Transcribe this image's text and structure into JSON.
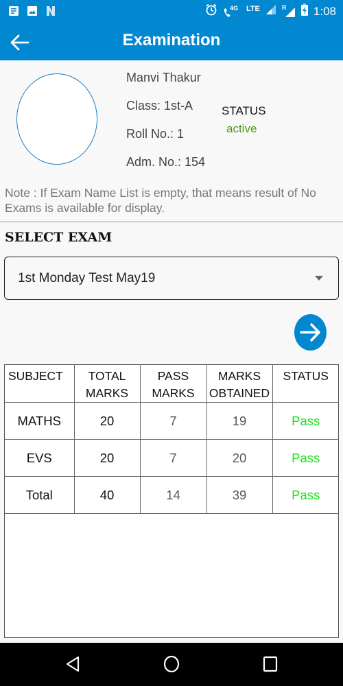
{
  "status_bar": {
    "left_icons": [
      "notes-icon",
      "image-icon",
      "n-app-icon"
    ],
    "right_icons": [
      "alarm-icon",
      "volte-call-icon",
      "signal-icon",
      "roaming-signal-icon",
      "battery-charging-icon"
    ],
    "network_label": "4G",
    "lte_label": "LTE",
    "roaming_label": "R",
    "time": "1:08"
  },
  "app_bar": {
    "title": "Examination",
    "back_icon": "arrow-back-icon"
  },
  "student": {
    "name": "Manvi  Thakur",
    "class": "Class: 1st-A",
    "roll_no": "Roll No.: 1",
    "adm_no": "Adm. No.: 154",
    "status_label": "STATUS",
    "status_value": "active"
  },
  "note": "Note : If Exam Name List is empty, that means result of No Exams is available for display.",
  "select_exam": {
    "heading": "SELECT EXAM",
    "selected": "1st Monday Test May19"
  },
  "results": {
    "headers": {
      "subject": "SUBJECT",
      "total_marks_1": "TOTAL",
      "total_marks_2": "MARKS",
      "pass_marks_1": "PASS",
      "pass_marks_2": "MARKS",
      "marks_obtained_1": "MARKS",
      "marks_obtained_2": "OBTAINED",
      "status": "STATUS"
    },
    "rows": [
      {
        "subject": "MATHS",
        "total": "20",
        "pass": "7",
        "obtained": "19",
        "status": "Pass"
      },
      {
        "subject": "EVS",
        "total": "20",
        "pass": "7",
        "obtained": "20",
        "status": "Pass"
      },
      {
        "subject": "Total",
        "total": "40",
        "pass": "14",
        "obtained": "39",
        "status": "Pass"
      }
    ]
  },
  "colors": {
    "primary": "#0288d1",
    "active_status": "#4a9a0e",
    "pass_status": "#22dd22"
  },
  "nav_bar": {
    "buttons": [
      "back-nav-icon",
      "home-nav-icon",
      "recents-nav-icon"
    ]
  }
}
